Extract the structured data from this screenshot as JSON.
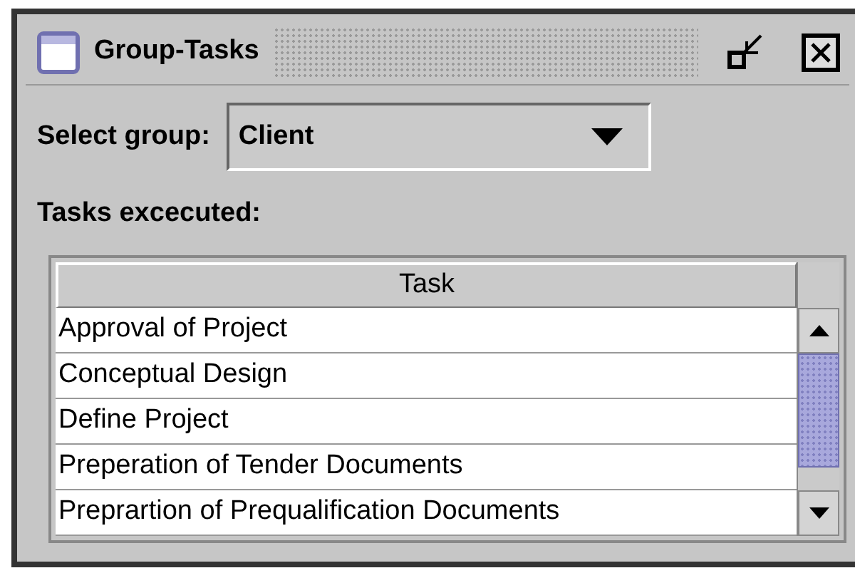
{
  "window": {
    "title": "Group-Tasks"
  },
  "group_select": {
    "label": "Select group:",
    "value": "Client"
  },
  "tasks_label": "Tasks excecuted:",
  "table": {
    "columns": [
      "Task"
    ],
    "rows": [
      [
        "Approval of Project"
      ],
      [
        "Conceptual Design"
      ],
      [
        "Define Project"
      ],
      [
        "Preperation of Tender Documents"
      ],
      [
        "Preprartion of Prequalification Documents"
      ]
    ]
  }
}
